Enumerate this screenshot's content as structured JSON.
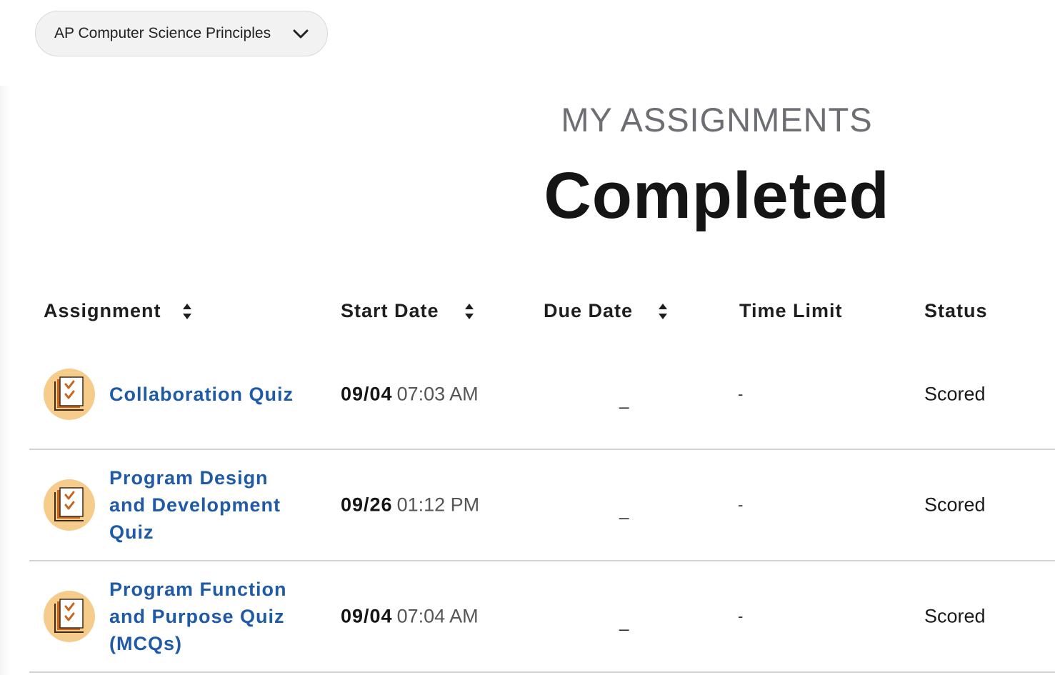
{
  "course_selector": {
    "label": "AP Computer Science Principles"
  },
  "header": {
    "section_title": "MY ASSIGNMENTS",
    "status_title": "Completed"
  },
  "table": {
    "columns": {
      "assignment": "Assignment",
      "start_date": "Start Date",
      "due_date": "Due Date",
      "time_limit": "Time Limit",
      "status": "Status"
    },
    "rows": [
      {
        "title": "Collaboration Quiz",
        "start_day": "09/04",
        "start_time": "07:03 AM",
        "due_date": "_",
        "time_limit": "-",
        "status": "Scored"
      },
      {
        "title": "Program Design and Development Quiz",
        "start_day": "09/26",
        "start_time": "01:12 PM",
        "due_date": "_",
        "time_limit": "-",
        "status": "Scored"
      },
      {
        "title": "Program Function and Purpose Quiz (MCQs)",
        "start_day": "09/04",
        "start_time": "07:04 AM",
        "due_date": "_",
        "time_limit": "-",
        "status": "Scored"
      }
    ]
  },
  "colors": {
    "link": "#1f5aa6",
    "icon_bg": "#f5cc8c",
    "icon_accent": "#c8641e"
  },
  "icons": {
    "course_dropdown": "chevron-down-icon",
    "sort": "sort-icon",
    "assignment": "quiz-checklist-icon"
  }
}
